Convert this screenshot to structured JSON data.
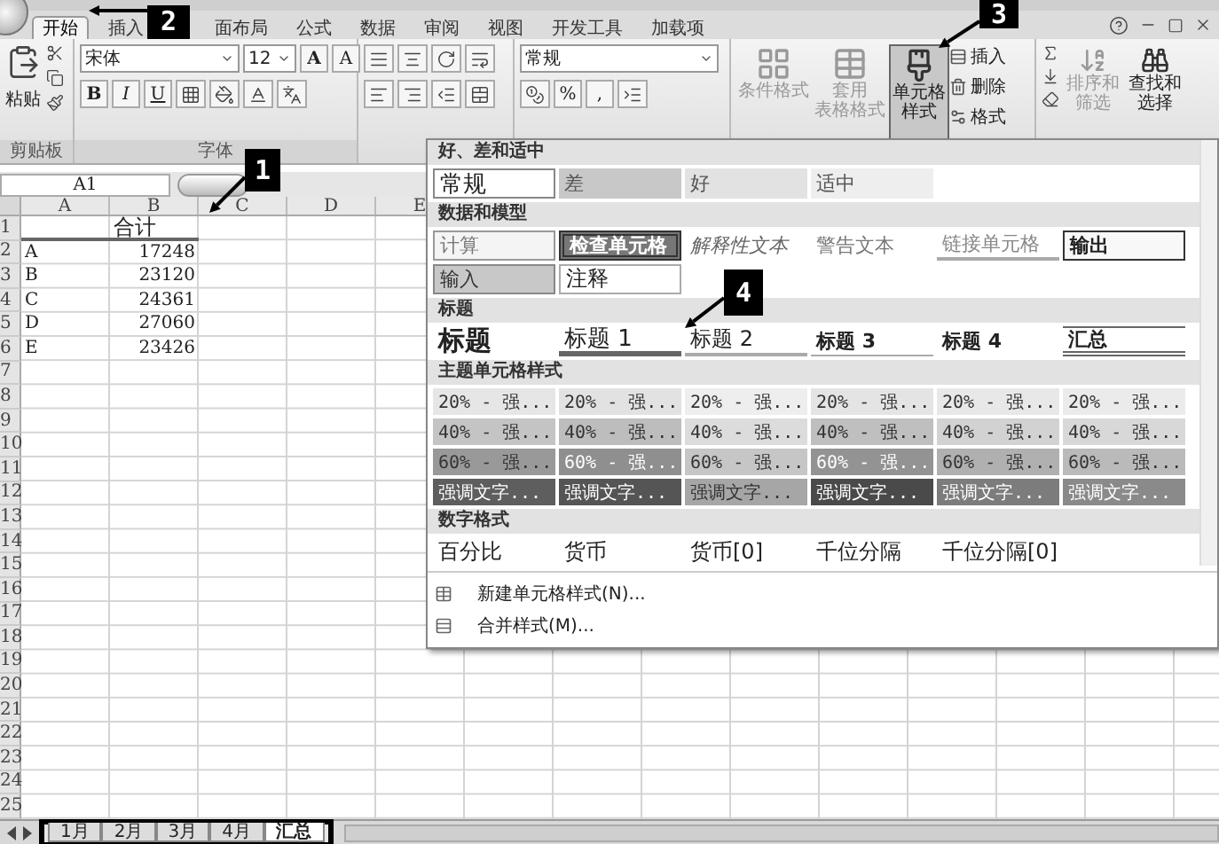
{
  "tabs": [
    {
      "label": "开始",
      "selected": true
    },
    {
      "label": "插入",
      "selected": false
    },
    {
      "label": "面布局",
      "selected": false
    },
    {
      "label": "公式",
      "selected": false
    },
    {
      "label": "数据",
      "selected": false
    },
    {
      "label": "审阅",
      "selected": false
    },
    {
      "label": "视图",
      "selected": false
    },
    {
      "label": "开发工具",
      "selected": false
    },
    {
      "label": "加载项",
      "selected": false
    }
  ],
  "clipboard": {
    "paste_label": "粘贴",
    "group_label": "剪贴板"
  },
  "font": {
    "name": "宋体",
    "size": "12",
    "grow": "A",
    "shrink": "A",
    "format_buttons": [
      "B",
      "I",
      "U"
    ],
    "group_label": "字体"
  },
  "number": {
    "format": "常规",
    "buttons": [
      "%",
      ","
    ]
  },
  "styles": {
    "buttons": [
      {
        "lines": [
          "条件格式"
        ],
        "selected": false,
        "disabled": true
      },
      {
        "lines": [
          "套用",
          "表格格式"
        ],
        "selected": false,
        "disabled": true
      },
      {
        "lines": [
          "单元格",
          "样式"
        ],
        "selected": true,
        "disabled": false
      }
    ]
  },
  "cells": {
    "buttons": [
      "插入",
      "删除",
      "格式"
    ]
  },
  "editing": {
    "buttons": [
      {
        "lines": [
          "排序和",
          "筛选"
        ],
        "disabled": true
      },
      {
        "lines": [
          "查找和",
          "选择"
        ],
        "disabled": false
      }
    ]
  },
  "formula_bar": {
    "name_box": "A1"
  },
  "sheet": {
    "columns": [
      "A",
      "B",
      "C",
      "D",
      "E"
    ],
    "rows": [
      {
        "number": "1",
        "b": "合计",
        "kind": "header"
      },
      {
        "number": "2",
        "a": "A",
        "b": "17248"
      },
      {
        "number": "3",
        "a": "B",
        "b": "23120"
      },
      {
        "number": "4",
        "a": "C",
        "b": "24361"
      },
      {
        "number": "5",
        "a": "D",
        "b": "27060"
      },
      {
        "number": "6",
        "a": "E",
        "b": "23426"
      },
      {
        "number": "7"
      },
      {
        "number": "8"
      },
      {
        "number": "9"
      },
      {
        "number": "10"
      },
      {
        "number": "11"
      },
      {
        "number": "12"
      },
      {
        "number": "13"
      },
      {
        "number": "14"
      },
      {
        "number": "15"
      },
      {
        "number": "16"
      },
      {
        "number": "17"
      },
      {
        "number": "18"
      },
      {
        "number": "19"
      },
      {
        "number": "20"
      },
      {
        "number": "21"
      },
      {
        "number": "22"
      },
      {
        "number": "23"
      },
      {
        "number": "24"
      },
      {
        "number": "25"
      }
    ]
  },
  "sheet_tabs": [
    {
      "label": "1月",
      "selected": false
    },
    {
      "label": "2月",
      "selected": false
    },
    {
      "label": "3月",
      "selected": false
    },
    {
      "label": "4月",
      "selected": false
    },
    {
      "label": "汇总",
      "selected": true
    }
  ],
  "cell_styles_gallery": {
    "sections": [
      {
        "title": "好、差和适中",
        "items": [
          {
            "label": "常规",
            "kind": "normal"
          },
          {
            "label": "差",
            "kind": "bad"
          },
          {
            "label": "好",
            "kind": "good"
          },
          {
            "label": "适中",
            "kind": "neutral"
          }
        ]
      },
      {
        "title": "数据和模型",
        "items": [
          {
            "label": "计算",
            "kind": "calculation"
          },
          {
            "label": "检查单元格",
            "kind": "check"
          },
          {
            "label": "解释性文本",
            "kind": "explanatory"
          },
          {
            "label": "警告文本",
            "kind": "warning"
          },
          {
            "label": "链接单元格",
            "kind": "linked"
          },
          {
            "label": "输出",
            "kind": "output"
          },
          {
            "label": "输入",
            "kind": "input"
          },
          {
            "label": "注释",
            "kind": "note"
          }
        ]
      },
      {
        "title": "标题",
        "items": [
          {
            "label": "标题",
            "kind": "title"
          },
          {
            "label": "标题 1",
            "kind": "heading1"
          },
          {
            "label": "标题 2",
            "kind": "heading2"
          },
          {
            "label": "标题 3",
            "kind": "heading3"
          },
          {
            "label": "标题 4",
            "kind": "heading4"
          },
          {
            "label": "汇总",
            "kind": "total"
          }
        ]
      },
      {
        "title": "主题单元格样式",
        "items": [
          {
            "label": "20% - 强...",
            "kind": "theme",
            "color": "#e6e6e6"
          },
          {
            "label": "20% - 强...",
            "kind": "theme",
            "color": "#e2e2e2"
          },
          {
            "label": "20% - 强...",
            "kind": "theme",
            "color": "#eeeeee"
          },
          {
            "label": "20% - 强...",
            "kind": "theme",
            "color": "#e4e4e4"
          },
          {
            "label": "20% - 强...",
            "kind": "theme",
            "color": "#e8e8e8"
          },
          {
            "label": "20% - 强...",
            "kind": "theme",
            "color": "#ebebeb"
          },
          {
            "label": "40% - 强...",
            "kind": "theme",
            "color": "#c4c4c4"
          },
          {
            "label": "40% - 强...",
            "kind": "theme",
            "color": "#bdbdbd"
          },
          {
            "label": "40% - 强...",
            "kind": "theme",
            "color": "#dcdcdc"
          },
          {
            "label": "40% - 强...",
            "kind": "theme",
            "color": "#bfbfbf"
          },
          {
            "label": "40% - 强...",
            "kind": "theme",
            "color": "#d2d2d2"
          },
          {
            "label": "40% - 强...",
            "kind": "theme",
            "color": "#d8d8d8"
          },
          {
            "label": "60% - 强...",
            "kind": "theme",
            "color": "#999999"
          },
          {
            "label": "60% - 强...",
            "kind": "theme",
            "color": "#8f8f8f"
          },
          {
            "label": "60% - 强...",
            "kind": "theme",
            "color": "#c6c6c6"
          },
          {
            "label": "60% - 强...",
            "kind": "theme",
            "color": "#939393"
          },
          {
            "label": "60% - 强...",
            "kind": "theme",
            "color": "#b0b0b0"
          },
          {
            "label": "60% - 强...",
            "kind": "theme",
            "color": "#bababa"
          },
          {
            "label": "强调文字...",
            "kind": "theme",
            "color": "#5e5e5e"
          },
          {
            "label": "强调文字...",
            "kind": "theme",
            "color": "#555555"
          },
          {
            "label": "强调文字...",
            "kind": "theme",
            "color": "#a6a6a6"
          },
          {
            "label": "强调文字...",
            "kind": "theme",
            "color": "#4a4a4a"
          },
          {
            "label": "强调文字...",
            "kind": "theme",
            "color": "#7c7c7c"
          },
          {
            "label": "强调文字...",
            "kind": "theme",
            "color": "#8a8a8a"
          }
        ]
      },
      {
        "title": "数字格式",
        "items": [
          {
            "label": "百分比",
            "kind": "number"
          },
          {
            "label": "货币",
            "kind": "number"
          },
          {
            "label": "货币[0]",
            "kind": "number"
          },
          {
            "label": "千位分隔",
            "kind": "number"
          },
          {
            "label": "千位分隔[0]",
            "kind": "number"
          }
        ]
      }
    ],
    "commands": [
      {
        "label": "新建单元格样式(N)..."
      },
      {
        "label": "合并样式(M)..."
      }
    ]
  },
  "callouts": [
    {
      "label": "1"
    },
    {
      "label": "2"
    },
    {
      "label": "3"
    },
    {
      "label": "4"
    }
  ]
}
